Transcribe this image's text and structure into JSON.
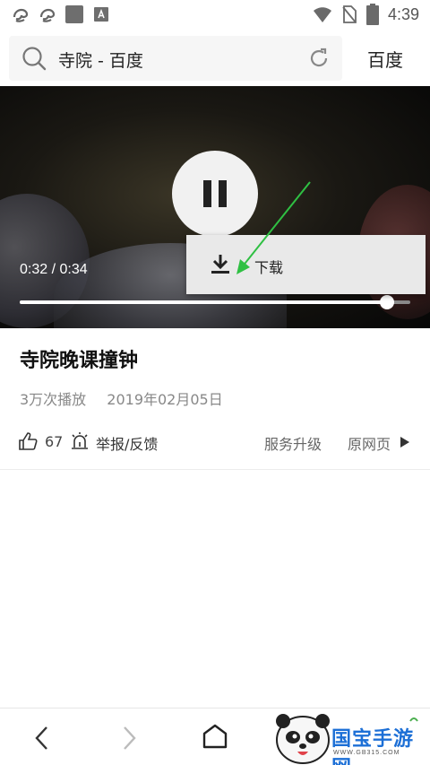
{
  "status_bar": {
    "time": "4:39",
    "left_icons": [
      "uc-browser-icon",
      "uc-browser-icon",
      "gallery-icon",
      "font-app-icon"
    ],
    "right_icons": [
      "wifi-icon",
      "no-sim-icon",
      "battery-icon"
    ]
  },
  "search": {
    "query": "寺院 - 百度",
    "engine_button": "百度"
  },
  "video": {
    "current_time": "0:32",
    "separator": "/",
    "duration": "0:34",
    "progress_fraction": 0.94,
    "state": "paused",
    "download_menu": {
      "label": "下载"
    }
  },
  "detail": {
    "title": "寺院晚课撞钟",
    "views": "3万次播放",
    "date": "2019年02月05日",
    "likes": "67",
    "report_label": "举报/反馈",
    "upgrade_label": "服务升级",
    "original_label": "原网页"
  },
  "watermark": {
    "text": "国宝手游网",
    "url": "WWW.GB315.COM"
  },
  "colors": {
    "accent_arrow": "#2fc043",
    "watermark_blue": "#1c6fd6"
  }
}
